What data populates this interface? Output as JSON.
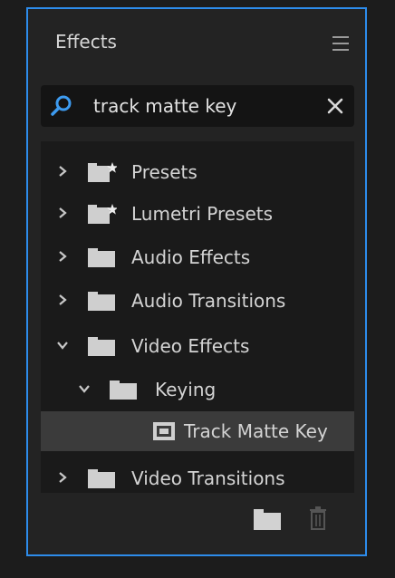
{
  "panel": {
    "title": "Effects"
  },
  "search": {
    "value": "track matte key"
  },
  "tree": {
    "presets": "Presets",
    "lumetri_presets": "Lumetri Presets",
    "audio_effects": "Audio Effects",
    "audio_transitions": "Audio Transitions",
    "video_effects": "Video Effects",
    "keying": "Keying",
    "track_matte_key": "Track Matte Key",
    "video_transitions": "Video Transitions"
  },
  "colors": {
    "accent": "#2d8ceb",
    "panel_bg": "#232323",
    "tree_bg": "#1a1a1a",
    "selected_row": "#3b3b3b",
    "text": "#d4d4d4"
  }
}
